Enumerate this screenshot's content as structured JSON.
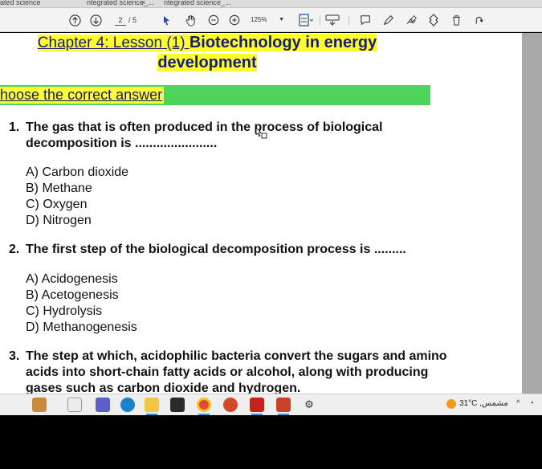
{
  "tabs": [
    {
      "label": "ated science"
    },
    {
      "label": "ntegrated science_..."
    },
    {
      "label": "ntegrated science_..."
    }
  ],
  "toolbar": {
    "page_current": "2",
    "page_total": "/ 5",
    "zoom": "125%"
  },
  "document": {
    "chapter_part1": "Chapter 4: Lesson (1) ",
    "chapter_part2": "Biotechnology in energy",
    "chapter_line2": "development",
    "section_heading": "hoose the correct answer",
    "questions": [
      {
        "number": "1.",
        "line1": "The gas that is often produced in the process of biological",
        "line2": "decomposition is .......................",
        "options": [
          "A) Carbon dioxide",
          "B) Methane",
          "C) Oxygen",
          "D) Nitrogen"
        ]
      },
      {
        "number": "2.",
        "line1": "The first step of the biological decomposition process is .........",
        "options": [
          "A) Acidogenesis",
          "B) Acetogenesis",
          "C) Hydrolysis",
          "D) Methanogenesis"
        ]
      },
      {
        "number": "3.",
        "line1": "The step at which, acidophilic bacteria convert the sugars and amino",
        "line2": "acids into short-chain fatty acids or alcohol, along with producing",
        "line3": "gases such as carbon dioxide and hydrogen."
      }
    ]
  },
  "taskbar": {
    "weather": "31°C ,مشمس",
    "icons": [
      "start-icon",
      "task-view-icon",
      "teams-icon",
      "edge-icon",
      "file-explorer-icon",
      "store-icon",
      "chrome-icon",
      "word-icon",
      "acrobat-icon",
      "powerpoint-icon",
      "settings-icon"
    ]
  },
  "colors": {
    "chapter_highlight": "#ffff2a",
    "banner_green": "#4fd35a",
    "scrollbar": "#a9a9a9"
  }
}
